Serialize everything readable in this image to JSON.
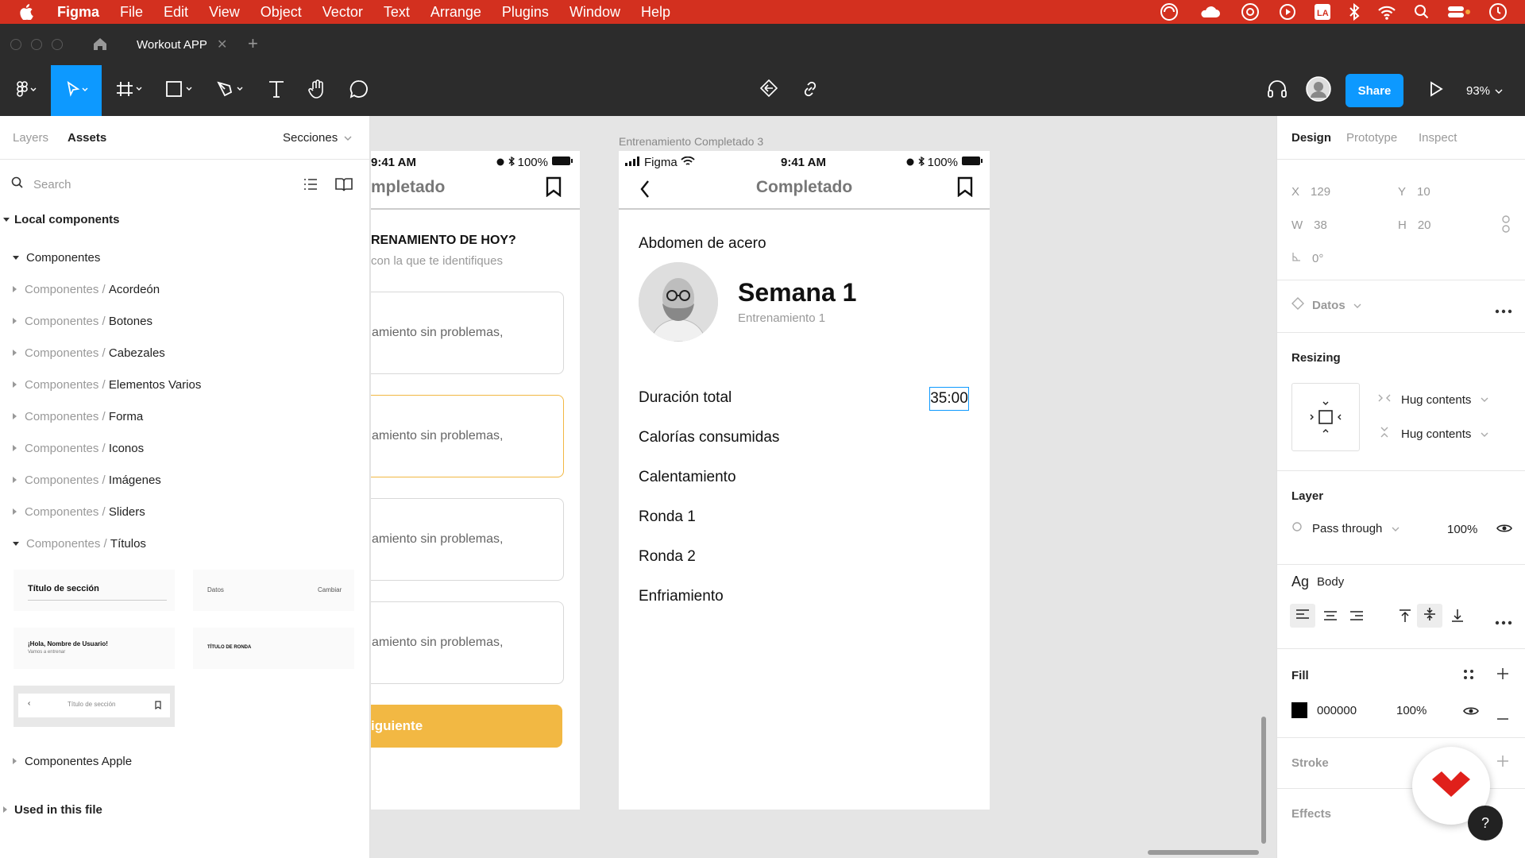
{
  "menubar": {
    "app": "Figma",
    "items": [
      "File",
      "Edit",
      "View",
      "Object",
      "Vector",
      "Text",
      "Arrange",
      "Plugins",
      "Window",
      "Help"
    ]
  },
  "tabbar": {
    "file_tab": "Workout APP"
  },
  "toolbar": {
    "share_label": "Share",
    "zoom": "93%"
  },
  "left_panel": {
    "tabs": {
      "layers": "Layers",
      "assets": "Assets"
    },
    "sections_label": "Secciones",
    "search_placeholder": "Search",
    "local_components": "Local components",
    "componentes": "Componentes",
    "prefix": "Componentes /",
    "groups": [
      "Acordeón",
      "Botones",
      "Cabezales",
      "Elementos Varios",
      "Forma",
      "Iconos",
      "Imágenes",
      "Sliders"
    ],
    "titulos_group": "Títulos",
    "thumbs": {
      "t1": "Título de sección",
      "t2a": "Datos",
      "t2b": "Cambiar",
      "t3a": "¡Hola, Nombre de Usuario!",
      "t3b": "Vamos a entrenar",
      "t4": "TÍTULO DE RONDA",
      "t5": "Título de sección"
    },
    "apple": "Componentes Apple",
    "used": "Used in this file"
  },
  "frame_left": {
    "time": "9:41 AM",
    "battery": "100%",
    "title": "mpletado",
    "question": "RENAMIENTO DE HOY?",
    "subtitle": "con la que te identifiques",
    "cards": [
      "amiento sin problemas,",
      "amiento sin problemas,",
      "amiento sin problemas,",
      "amiento sin problemas,"
    ],
    "button": "iguiente"
  },
  "frame_right": {
    "label": "Entrenamiento Completado 3",
    "carrier": "Figma",
    "time": "9:41 AM",
    "battery": "100%",
    "title": "Completado",
    "program": "Abdomen de acero",
    "week": "Semana 1",
    "session": "Entrenamiento 1",
    "rows": [
      "Duración total",
      "Calorías consumidas",
      "Calentamiento",
      "Ronda 1",
      "Ronda 2",
      "Enfriamiento"
    ],
    "duration_value": "35:00"
  },
  "right_panel": {
    "tabs": {
      "design": "Design",
      "prototype": "Prototype",
      "inspect": "Inspect"
    },
    "x_label": "X",
    "x": "129",
    "y_label": "Y",
    "y": "10",
    "w_label": "W",
    "w": "38",
    "h_label": "H",
    "h": "20",
    "rotation": "0°",
    "component": "Datos",
    "resizing": "Resizing",
    "hug_h": "Hug contents",
    "hug_v": "Hug contents",
    "layer": "Layer",
    "blend": "Pass through",
    "opacity": "100%",
    "text_style_prefix": "Ag",
    "text_style": "Body",
    "fill": "Fill",
    "fill_hex": "000000",
    "fill_opacity": "100%",
    "stroke": "Stroke",
    "effects": "Effects"
  },
  "colors": {
    "menubar": "#d3301f",
    "accent": "#0d99ff",
    "cta": "#f2b843",
    "dark": "#2c2c2c"
  }
}
